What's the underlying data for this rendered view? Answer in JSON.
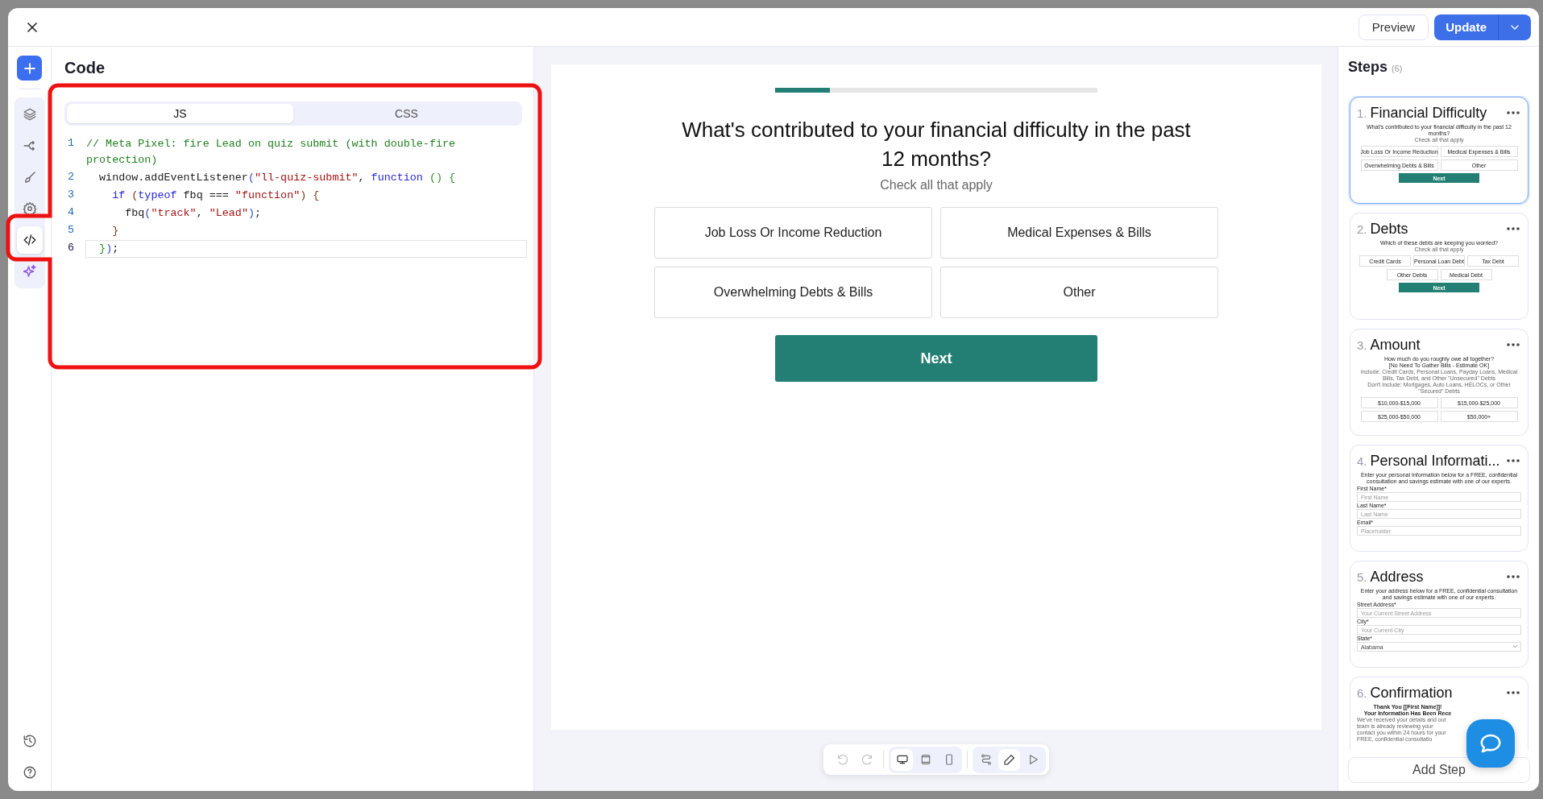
{
  "header": {
    "preview_button": "Preview",
    "update_button": "Update"
  },
  "rail": {
    "items": [
      {
        "selected": false
      },
      {
        "selected": false
      },
      {
        "selected": false
      },
      {
        "selected": false
      },
      {
        "selected": true
      },
      {
        "selected": false
      }
    ]
  },
  "code_panel": {
    "title": "Code",
    "tabs": [
      {
        "label": "JS",
        "selected": true
      },
      {
        "label": "CSS",
        "selected": false
      }
    ],
    "lines": [
      {
        "number": "1",
        "current": false,
        "tokens": [
          {
            "text": "// Meta Pixel: fire Lead on quiz submit (with double-fire protection)",
            "kind": "comment"
          }
        ]
      },
      {
        "number": "2",
        "current": false,
        "tokens": [
          {
            "text": "  window.addEventListener",
            "kind": "plain"
          },
          {
            "text": "(",
            "kind": "bracket1"
          },
          {
            "text": "\"ll-quiz-submit\"",
            "kind": "string"
          },
          {
            "text": ", ",
            "kind": "plain"
          },
          {
            "text": "function",
            "kind": "keyword"
          },
          {
            "text": " () {",
            "kind": "bracket2"
          }
        ]
      },
      {
        "number": "3",
        "current": false,
        "tokens": [
          {
            "text": "    if",
            "kind": "keyword"
          },
          {
            "text": " (",
            "kind": "bracket3"
          },
          {
            "text": "typeof",
            "kind": "keyword"
          },
          {
            "text": " fbq === ",
            "kind": "plain"
          },
          {
            "text": "\"function\"",
            "kind": "string"
          },
          {
            "text": ") {",
            "kind": "bracket3"
          }
        ]
      },
      {
        "number": "4",
        "current": false,
        "tokens": [
          {
            "text": "      fbq",
            "kind": "plain"
          },
          {
            "text": "(",
            "kind": "bracket1"
          },
          {
            "text": "\"track\"",
            "kind": "string"
          },
          {
            "text": ", ",
            "kind": "plain"
          },
          {
            "text": "\"Lead\"",
            "kind": "string"
          },
          {
            "text": ")",
            "kind": "bracket1"
          },
          {
            "text": ";",
            "kind": "plain"
          }
        ]
      },
      {
        "number": "5",
        "current": false,
        "tokens": [
          {
            "text": "    }",
            "kind": "bracket3"
          }
        ]
      },
      {
        "number": "6",
        "current": true,
        "tokens": [
          {
            "text": "  }",
            "kind": "bracket2"
          },
          {
            "text": ")",
            "kind": "bracket1"
          },
          {
            "text": ";",
            "kind": "plain"
          }
        ]
      }
    ]
  },
  "quiz": {
    "progress": {
      "level": 0.17
    },
    "question": "What's contributed to your financial difficulty in the past 12 months?",
    "hint": "Check all that apply",
    "options": [
      "Job Loss Or Income Reduction",
      "Medical Expenses & Bills",
      "Overwhelming Debts & Bills",
      "Other"
    ],
    "next_button": "Next"
  },
  "toolbar": {
    "history": [
      {
        "disabled": true
      },
      {
        "disabled": true
      }
    ],
    "devices": [
      {
        "selected": true
      },
      {
        "selected": false
      },
      {
        "selected": false
      }
    ],
    "modes": [
      {
        "selected": false
      },
      {
        "selected": true
      },
      {
        "selected": false
      }
    ]
  },
  "steps": {
    "title": "Steps",
    "count": "(6)",
    "add_button": "Add Step",
    "items": [
      {
        "number": "1.",
        "title": "Financial Difficulty",
        "selected": true,
        "preview": {
          "kind": "choices",
          "heading": [
            "What's contributed to your financial difficulty in the past 12 months?"
          ],
          "notes": [
            "Check all that apply"
          ],
          "options": [
            "Job Loss Or Income Reduction",
            "Medical Expenses & Bills",
            "Overwhelming Debts & Bills",
            "Other"
          ],
          "button": "Next"
        }
      },
      {
        "number": "2.",
        "title": "Debts",
        "selected": false,
        "preview": {
          "kind": "choices",
          "heading": [
            "Which of these debts are keeping you worried?"
          ],
          "notes": [
            "Check all that apply"
          ],
          "options": [
            "Credit Cards",
            "Personal Loan Debt",
            "Tax Debt",
            "Other Debts",
            "Medical Debt"
          ],
          "button": "Next"
        }
      },
      {
        "number": "3.",
        "title": "Amount",
        "selected": false,
        "preview": {
          "kind": "choices",
          "heading": [
            "How much do you roughly owe all together?",
            "[No Need To Gather Bills - Estimate OK]"
          ],
          "notes": [
            "Include: Credit Cards, Personal Loans, Payday Loans, Medical Bills, Tax Debt, and Other \"Unsecured\" Debts",
            "Don't Include: Mortgages, Auto Loans, HELOCs, or Other \"Secured\" Debts"
          ],
          "options": [
            "$10,000-$15,000",
            "$15,000-$25,000",
            "$25,000-$50,000",
            "$50,000+"
          ]
        }
      },
      {
        "number": "4.",
        "title": "Personal Informati...",
        "selected": false,
        "preview": {
          "kind": "form",
          "heading": [
            "Enter your personal Information below for a FREE, confidential consultation and savings estimate with one of our experts."
          ],
          "fields": [
            {
              "label": "First Name*",
              "placeholder": "First Name",
              "kind": "text"
            },
            {
              "label": "Last Name*",
              "placeholder": "Last Name",
              "kind": "text"
            },
            {
              "label": "Email*",
              "placeholder": "Placeholder",
              "kind": "text"
            }
          ]
        }
      },
      {
        "number": "5.",
        "title": "Address",
        "selected": false,
        "preview": {
          "kind": "form",
          "heading": [
            "Enter your address below for a FREE, confidential consultation and savings estimate with one of our experts."
          ],
          "fields": [
            {
              "label": "Street Address*",
              "placeholder": "Your Current Street Address",
              "kind": "text"
            },
            {
              "label": "City*",
              "placeholder": "Your Current City",
              "kind": "text"
            },
            {
              "label": "State*",
              "placeholder": "Alabama",
              "kind": "select"
            }
          ]
        }
      },
      {
        "number": "6.",
        "title": "Confirmation",
        "selected": false,
        "preview": {
          "kind": "message",
          "heading": [
            "Thank You [[First Name]]!",
            "Your Information Has Been Rece"
          ],
          "notes": [
            "We've received your details and our team is already reviewing your",
            "contact you within 24 hours for your FREE, confidential consultatio"
          ]
        }
      }
    ]
  }
}
